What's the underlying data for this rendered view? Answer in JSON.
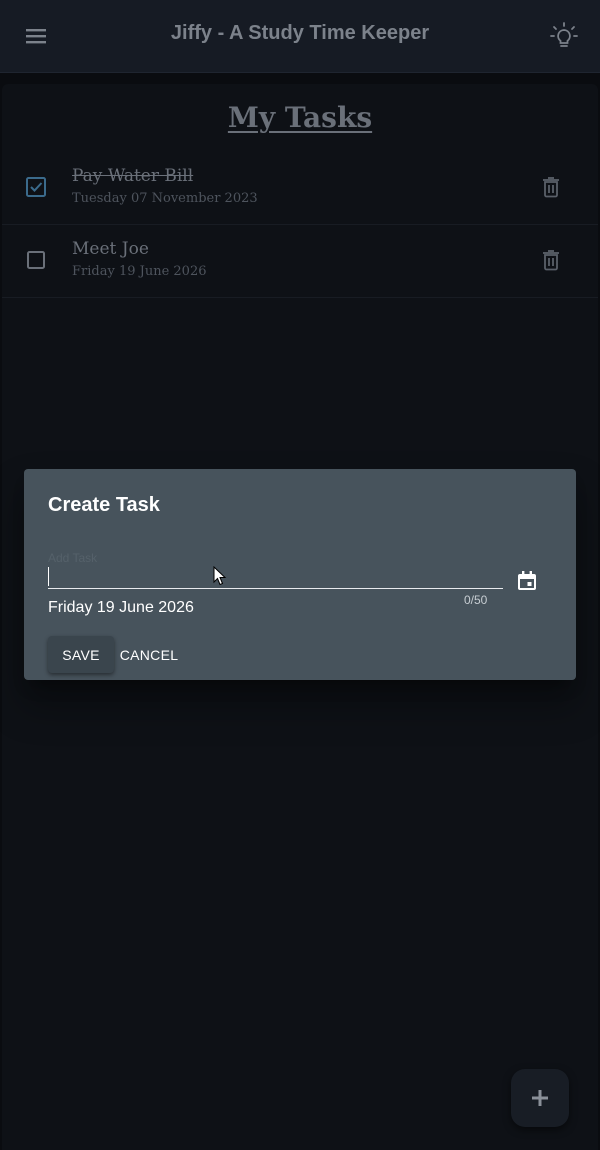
{
  "app_bar": {
    "title": "Jiffy - A Study Time Keeper",
    "menu_icon": "menu-icon",
    "theme_icon": "lightbulb-icon"
  },
  "page": {
    "title": "My Tasks"
  },
  "tasks": [
    {
      "title": "Pay Water Bill",
      "date": "Tuesday 07 November 2023",
      "completed": true
    },
    {
      "title": "Meet Joe",
      "date": "Friday 19 June 2026",
      "completed": false
    }
  ],
  "dialog": {
    "title": "Create Task",
    "input_label": "Add Task",
    "input_value": "",
    "counter": "0/50",
    "date": "Friday 19 June 2026",
    "save_label": "SAVE",
    "cancel_label": "CANCEL",
    "calendar_icon": "calendar-icon"
  },
  "fab": {
    "icon": "plus-icon"
  },
  "colors": {
    "background": "#0a0c10",
    "app_bar": "#161b24",
    "dialog": "#47535c",
    "text": "#ffffff",
    "dim_text": "#6a7079"
  }
}
